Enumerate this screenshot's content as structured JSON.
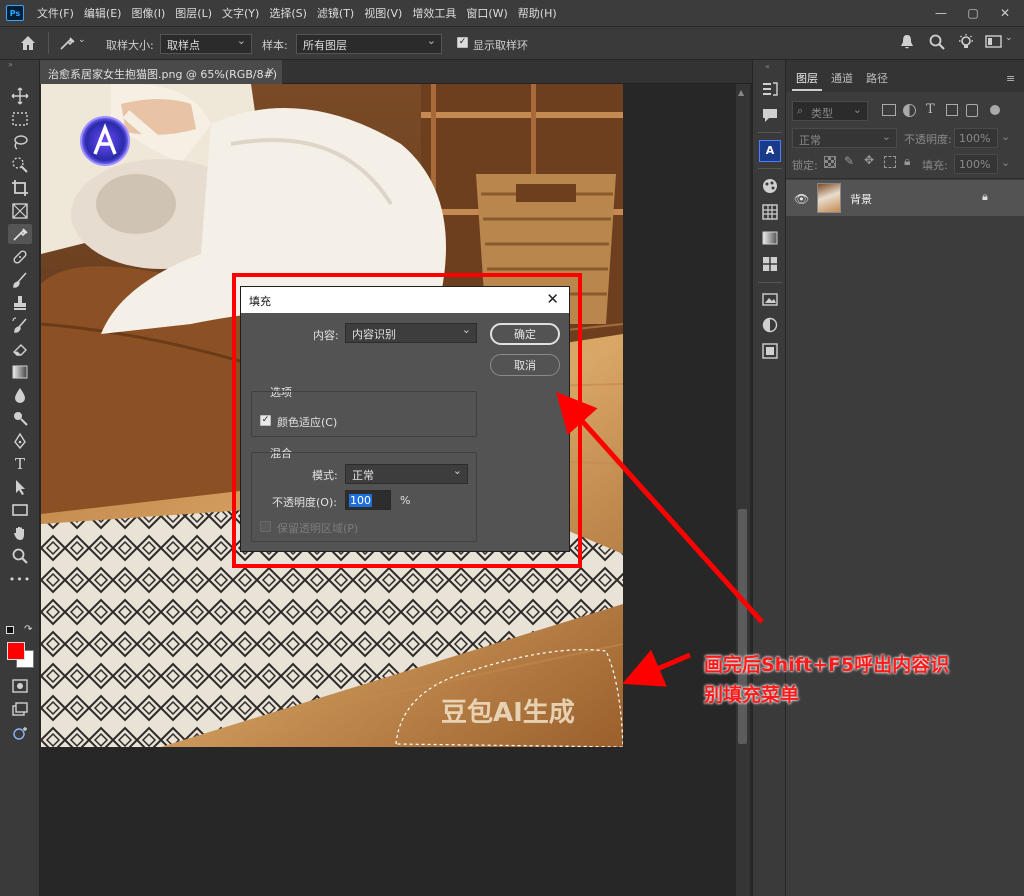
{
  "menubar": {
    "app_logo": "Ps",
    "items": [
      "文件(F)",
      "编辑(E)",
      "图像(I)",
      "图层(L)",
      "文字(Y)",
      "选择(S)",
      "滤镜(T)",
      "视图(V)",
      "增效工具",
      "窗口(W)",
      "帮助(H)"
    ]
  },
  "options": {
    "sample_size_label": "取样大小:",
    "sample_size_value": "取样点",
    "sample_label": "样本:",
    "sample_value": "所有图层",
    "show_ring_label": "显示取样环"
  },
  "document": {
    "tab_title": "治愈系居家女生抱猫图.png @ 65%(RGB/8#)",
    "watermark_text": "豆包AI生成"
  },
  "layers_panel": {
    "tabs": [
      "图层",
      "通道",
      "路径"
    ],
    "filter_label": "类型",
    "blend_mode": "正常",
    "opacity_label": "不透明度:",
    "opacity_value": "100%",
    "lock_label": "锁定:",
    "fill_label": "填充:",
    "fill_value": "100%",
    "layers": [
      {
        "name": "背景"
      }
    ]
  },
  "fill_dialog": {
    "title": "填充",
    "content_label": "内容:",
    "content_value": "内容识别",
    "ok_label": "确定",
    "cancel_label": "取消",
    "options_group": "选项",
    "color_adapt_label": "颜色适应(C)",
    "blend_group": "混合",
    "mode_label": "模式:",
    "mode_value": "正常",
    "opacity_label": "不透明度(O):",
    "opacity_value": "100",
    "opacity_unit": "%",
    "preserve_label": "保留透明区域(P)"
  },
  "annotation": {
    "line1": "画完后Shift+F5呼出内容识",
    "line2": "别填充菜单"
  },
  "colors": {
    "foreground": "#ff0000",
    "background": "#ffffff",
    "annotation_red": "#ff0000"
  }
}
